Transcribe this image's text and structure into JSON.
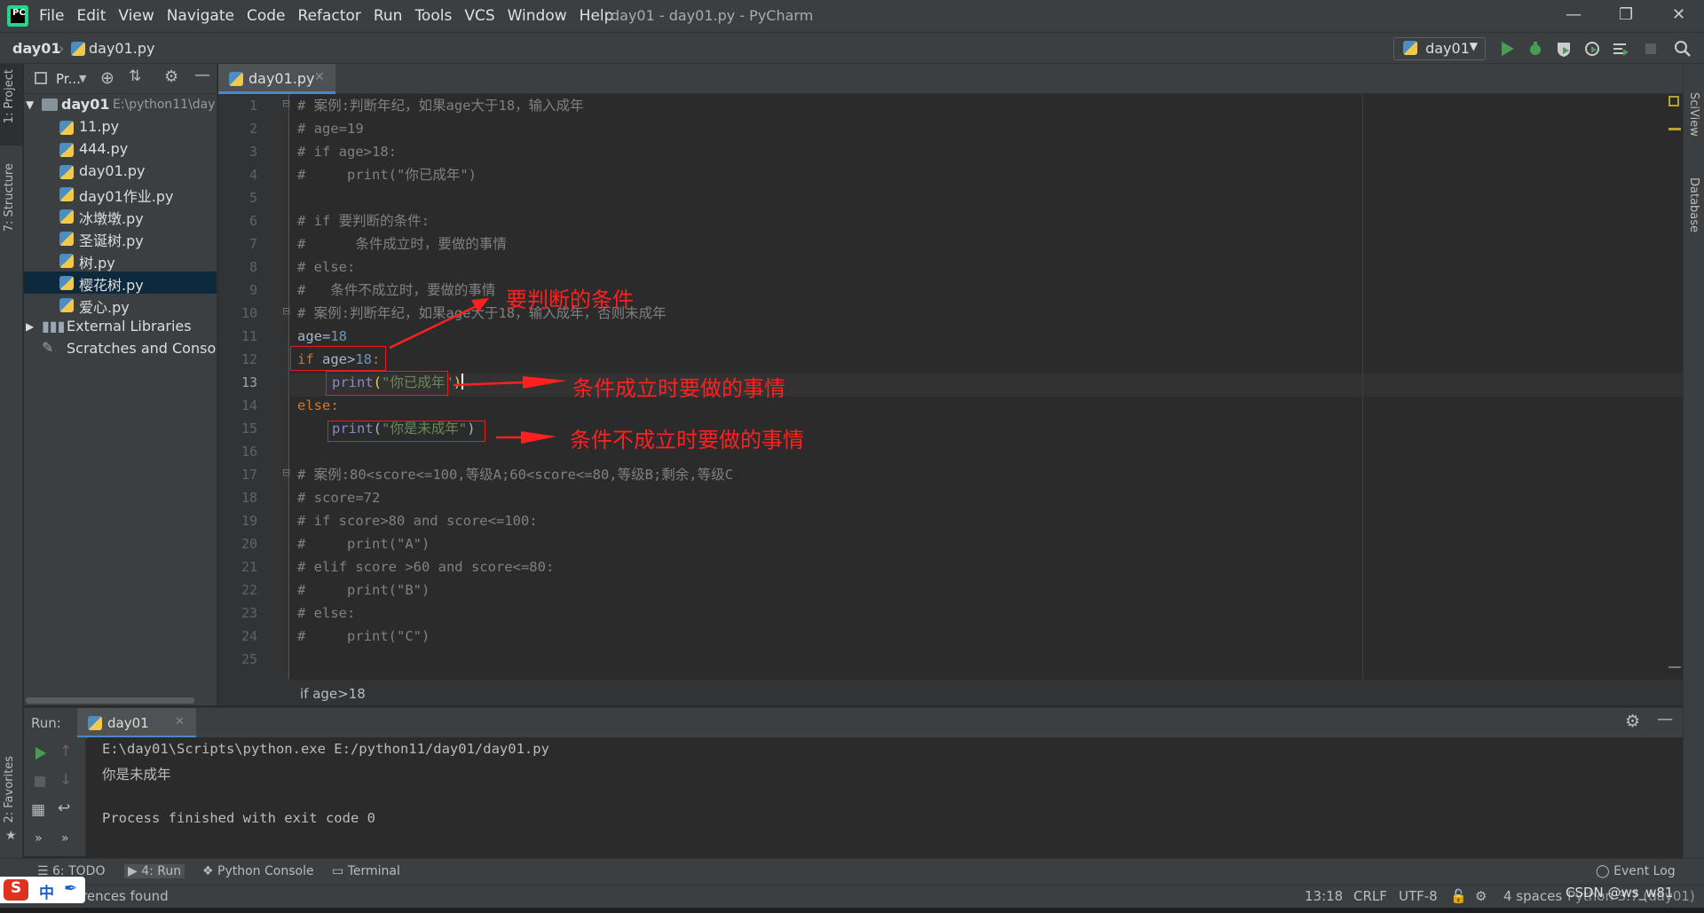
{
  "window": {
    "title": "day01 - day01.py - PyCharm",
    "menu": [
      "File",
      "Edit",
      "View",
      "Navigate",
      "Code",
      "Refactor",
      "Run",
      "Tools",
      "VCS",
      "Window",
      "Help"
    ]
  },
  "navbar": {
    "project": "day01",
    "file": "day01.py",
    "run_config": "day01"
  },
  "left_stripe": {
    "project_tab": "1: Project",
    "structure_tab": "7: Structure",
    "favorites_tab": "2: Favorites"
  },
  "right_stripe": {
    "sciview_tab": "SciView",
    "database_tab": "Database"
  },
  "project_panel": {
    "title": "Pr...",
    "root_name": "day01",
    "root_path": "E:\\python11\\day",
    "files": [
      "11.py",
      "444.py",
      "day01.py",
      "day01作业.py",
      "冰墩墩.py",
      "圣诞树.py",
      "树.py",
      "樱花树.py",
      "爱心.py"
    ],
    "selected_file": "樱花树.py",
    "external": "External Libraries",
    "scratches": "Scratches and Consoles"
  },
  "editor": {
    "tab_label": "day01.py",
    "current_line": 13,
    "line_numbers": [
      "1",
      "2",
      "3",
      "4",
      "5",
      "6",
      "7",
      "8",
      "9",
      "10",
      "11",
      "12",
      "13",
      "14",
      "15",
      "16",
      "17",
      "18",
      "19",
      "20",
      "21",
      "22",
      "23",
      "24",
      "25"
    ],
    "code": {
      "l1": "# 案例:判断年纪，如果age大于18，输入成年",
      "l2": "# age=19",
      "l3": "# if age>18:",
      "l4": "#     print(\"你已成年\")",
      "l6": "# if 要判断的条件:",
      "l7": "#      条件成立时，要做的事情",
      "l8": "# else:",
      "l9": "#   条件不成立时，要做的事情",
      "l10": "# 案例:判断年纪，如果age大于18，输入成年，否则未成年",
      "l11_a": "age=",
      "l11_b": "18",
      "l12_a": "if ",
      "l12_b": "age>",
      "l12_c": "18",
      "l12_d": ":",
      "l13_a": "print",
      "l13_b": "(",
      "l13_c": "\"你已成年\"",
      "l13_d": ")",
      "l14": "else:",
      "l15_a": "print",
      "l15_b": "(",
      "l15_c": "\"你是未成年\"",
      "l15_d": ")",
      "l17": "# 案例:80<score<=100,等级A;60<score<=80,等级B;剩余,等级C",
      "l18": "# score=72",
      "l19": "# if score>80 and score<=100:",
      "l20": "#     print(\"A\")",
      "l21": "# elif score >60 and score<=80:",
      "l22": "#     print(\"B\")",
      "l23": "# else:",
      "l24": "#     print(\"C\")"
    },
    "annotations": {
      "condition": "要判断的条件",
      "true_branch": "条件成立时要做的事情",
      "false_branch": "条件不成立时要做的事情"
    },
    "breadcrumb": "if age>18"
  },
  "run_panel": {
    "label": "Run:",
    "tab": "day01",
    "output": [
      "E:\\day01\\Scripts\\python.exe E:/python11/day01/day01.py",
      "你是未成年",
      "",
      "Process finished with exit code 0"
    ]
  },
  "bottom_tabs": {
    "todo": "6: TODO",
    "run": "4: Run",
    "python_console": "Python Console",
    "terminal": "Terminal",
    "event_log": "Event Log"
  },
  "status": {
    "message": "rences found",
    "position": "13:18",
    "line_sep": "CRLF",
    "encoding": "UTF-8",
    "indent": "4 spaces",
    "interpreter": "Python 3.7 (day01)",
    "watermark": "CSDN @ws_w81",
    "ime": "中"
  },
  "colors": {
    "accent": "#4a88c7",
    "annotation": "#ff2020",
    "keyword": "#cc7832",
    "string": "#6a8759",
    "number": "#6897bb"
  }
}
